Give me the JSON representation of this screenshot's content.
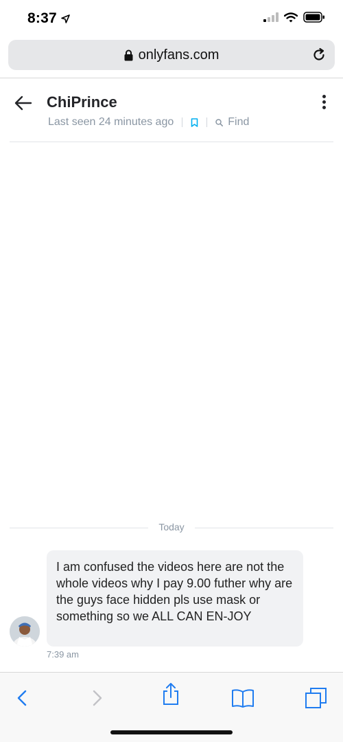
{
  "status": {
    "time": "8:37"
  },
  "browser": {
    "url": "onlyfans.com"
  },
  "chat": {
    "name": "ChiPrince",
    "last_seen": "Last seen 24 minutes ago",
    "find_label": "Find"
  },
  "date_separator": "Today",
  "messages": [
    {
      "text": "I am confused the videos here are not the whole videos why I pay 9.00 futher why are the guys face hidden pls use mask or something so we ALL CAN EN-JOY",
      "time": "7:39 am"
    }
  ],
  "colors": {
    "accent": "#00aff0",
    "muted": "#8a96a3",
    "bubble": "#f1f2f4",
    "ios_blue": "#1f7cf0"
  },
  "icons": {
    "location_arrow": "location-arrow-icon",
    "signal": "cell-signal-icon",
    "wifi": "wifi-icon",
    "battery": "battery-icon",
    "lock": "lock-icon",
    "reload": "reload-icon",
    "back": "back-arrow-icon",
    "bookmark": "bookmark-icon",
    "search": "search-icon",
    "more": "more-vertical-icon"
  }
}
